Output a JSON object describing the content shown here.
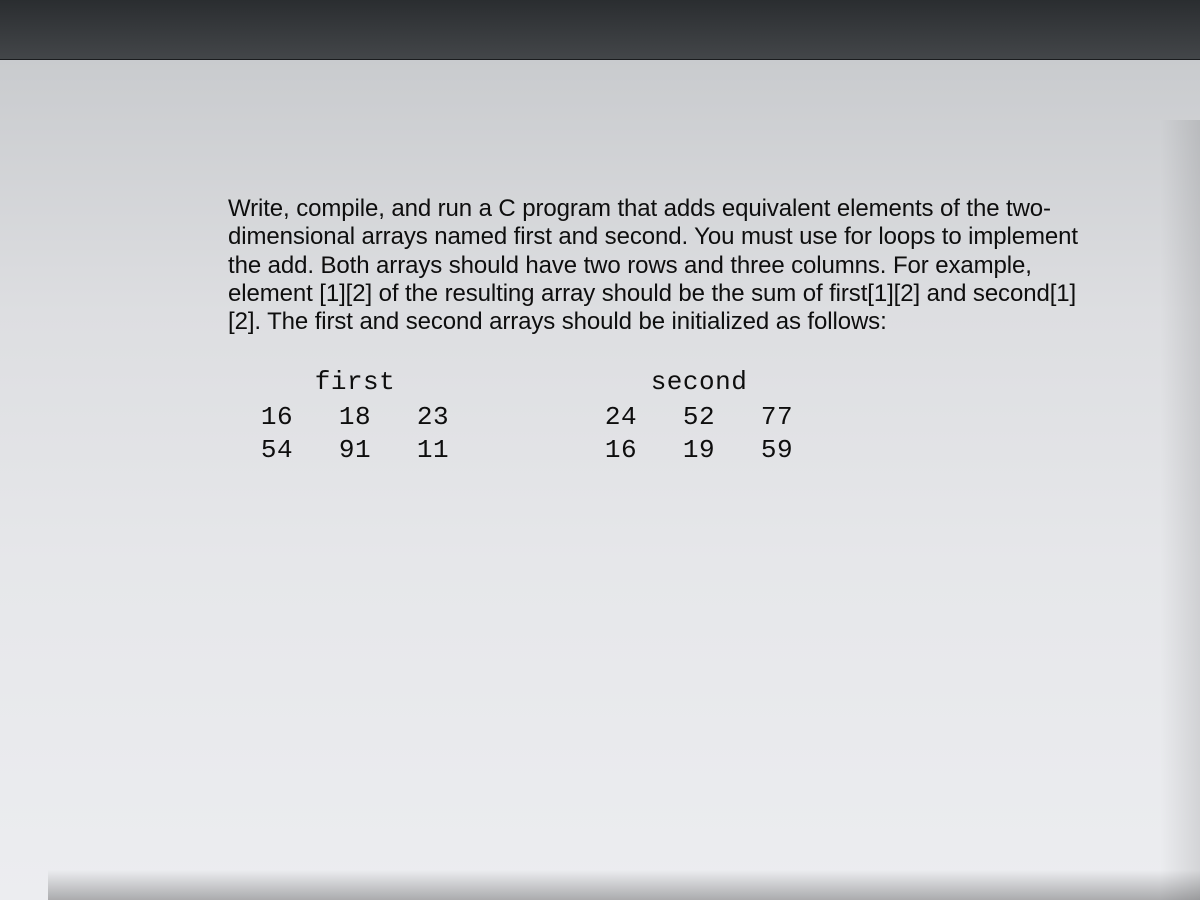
{
  "prompt_text": "Write, compile, and run a C program that adds equivalent elements of the two-dimensional arrays named first and second. You must use for loops to implement the add. Both arrays should have two rows and three columns. For example, element [1][2] of the resulting array should be the sum of first[1][2] and second[1][2]. The first and second arrays should be initialized as follows:",
  "arrays": {
    "first": {
      "label": "first",
      "rows": [
        [
          "16",
          "18",
          "23"
        ],
        [
          "54",
          "91",
          "11"
        ]
      ]
    },
    "second": {
      "label": "second",
      "rows": [
        [
          "24",
          "52",
          "77"
        ],
        [
          "16",
          "19",
          "59"
        ]
      ]
    }
  },
  "chart_data": {
    "type": "table",
    "tables": [
      {
        "name": "first",
        "rows": [
          [
            16,
            18,
            23
          ],
          [
            54,
            91,
            11
          ]
        ]
      },
      {
        "name": "second",
        "rows": [
          [
            24,
            52,
            77
          ],
          [
            16,
            19,
            59
          ]
        ]
      }
    ]
  }
}
